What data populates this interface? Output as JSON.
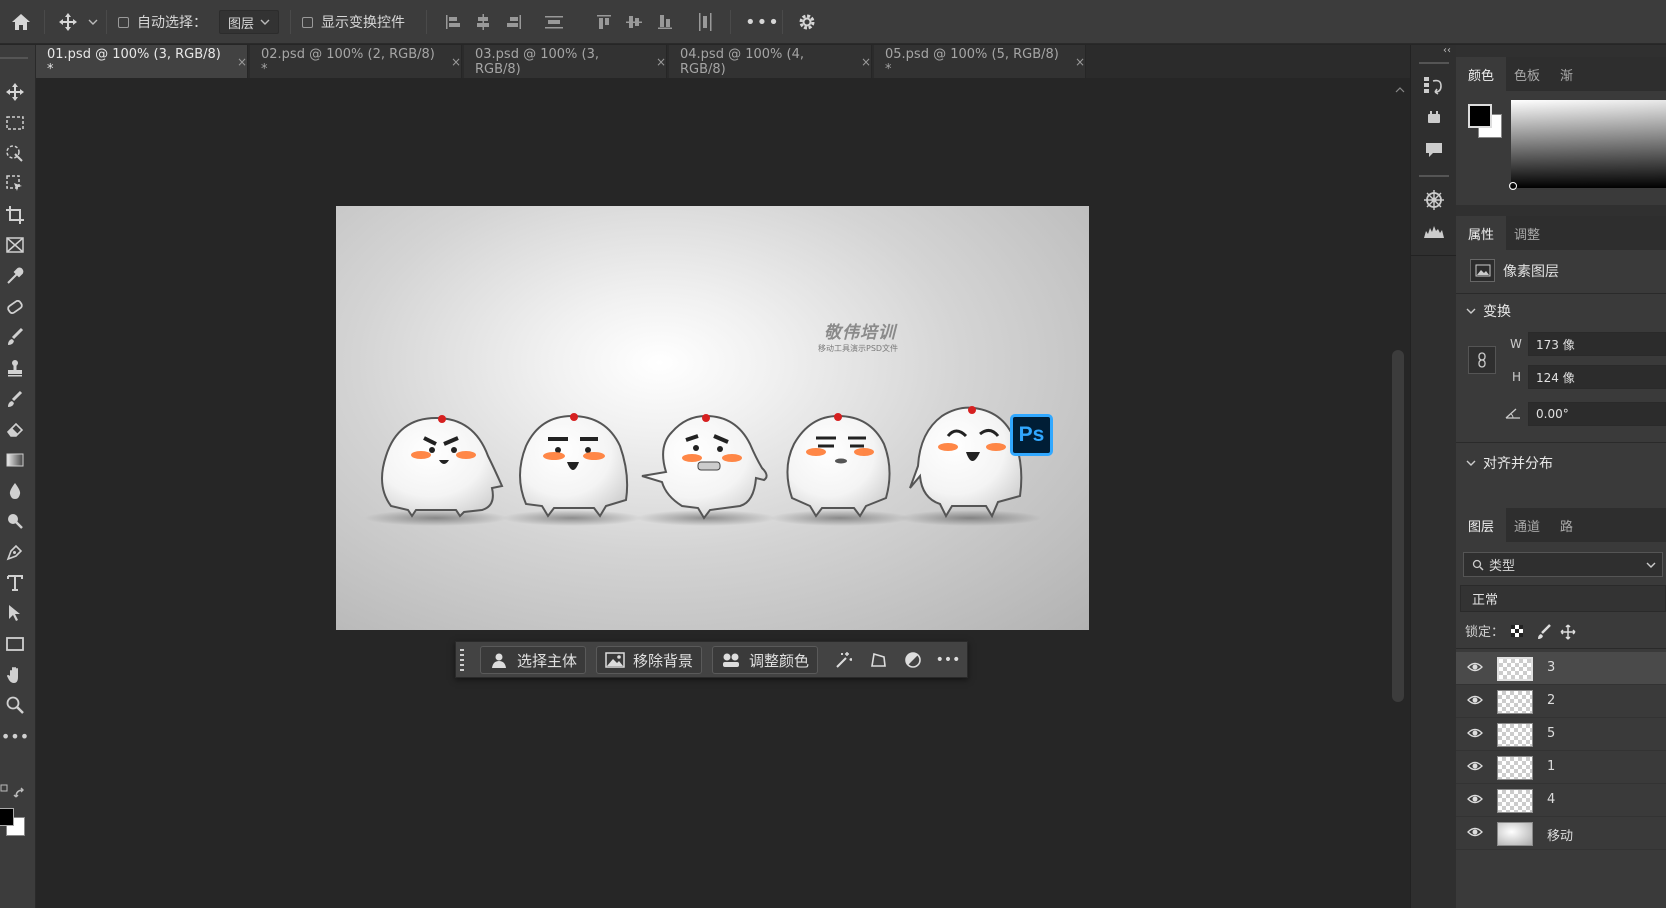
{
  "optionsbar": {
    "auto_select_label": "自动选择：",
    "auto_select_target": "图层",
    "show_transform_label": "显示变换控件"
  },
  "tabs": [
    {
      "label": "01.psd @ 100% (3, RGB/8) *"
    },
    {
      "label": "02.psd @ 100% (2, RGB/8) *"
    },
    {
      "label": "03.psd @ 100% (3, RGB/8)"
    },
    {
      "label": "04.psd @ 100% (4, RGB/8)"
    },
    {
      "label": "05.psd @ 100% (5, RGB/8) *"
    }
  ],
  "tab_close": "×",
  "canvas": {
    "watermark_title": "敬伟培训",
    "watermark_sub": "移动工具演示PSD文件",
    "badge": "Ps"
  },
  "contextbar": {
    "select_subject": "选择主体",
    "remove_bg": "移除背景",
    "adjust_color": "调整颜色"
  },
  "color_panel": {
    "tabs": [
      "颜色",
      "色板",
      "渐"
    ]
  },
  "properties_panel": {
    "tabs": [
      "属性",
      "调整"
    ],
    "layer_type": "像素图层",
    "transform_title": "变换",
    "w_label": "W",
    "w_value": "173 像",
    "h_label": "H",
    "h_value": "124 像",
    "angle_value": "0.00°",
    "align_title": "对齐并分布"
  },
  "layers_panel": {
    "tabs": [
      "图层",
      "通道",
      "路"
    ],
    "filter_kind": "类型",
    "blend_mode": "正常",
    "lock_label": "锁定：",
    "layers": [
      {
        "name": "3"
      },
      {
        "name": "2"
      },
      {
        "name": "5"
      },
      {
        "name": "1"
      },
      {
        "name": "4"
      },
      {
        "name": "移动"
      }
    ]
  },
  "colors": {
    "accent_ps": "#31a8ff",
    "ps_bg": "#001e36",
    "blush": "#ff7a33",
    "dot": "#d62020"
  }
}
